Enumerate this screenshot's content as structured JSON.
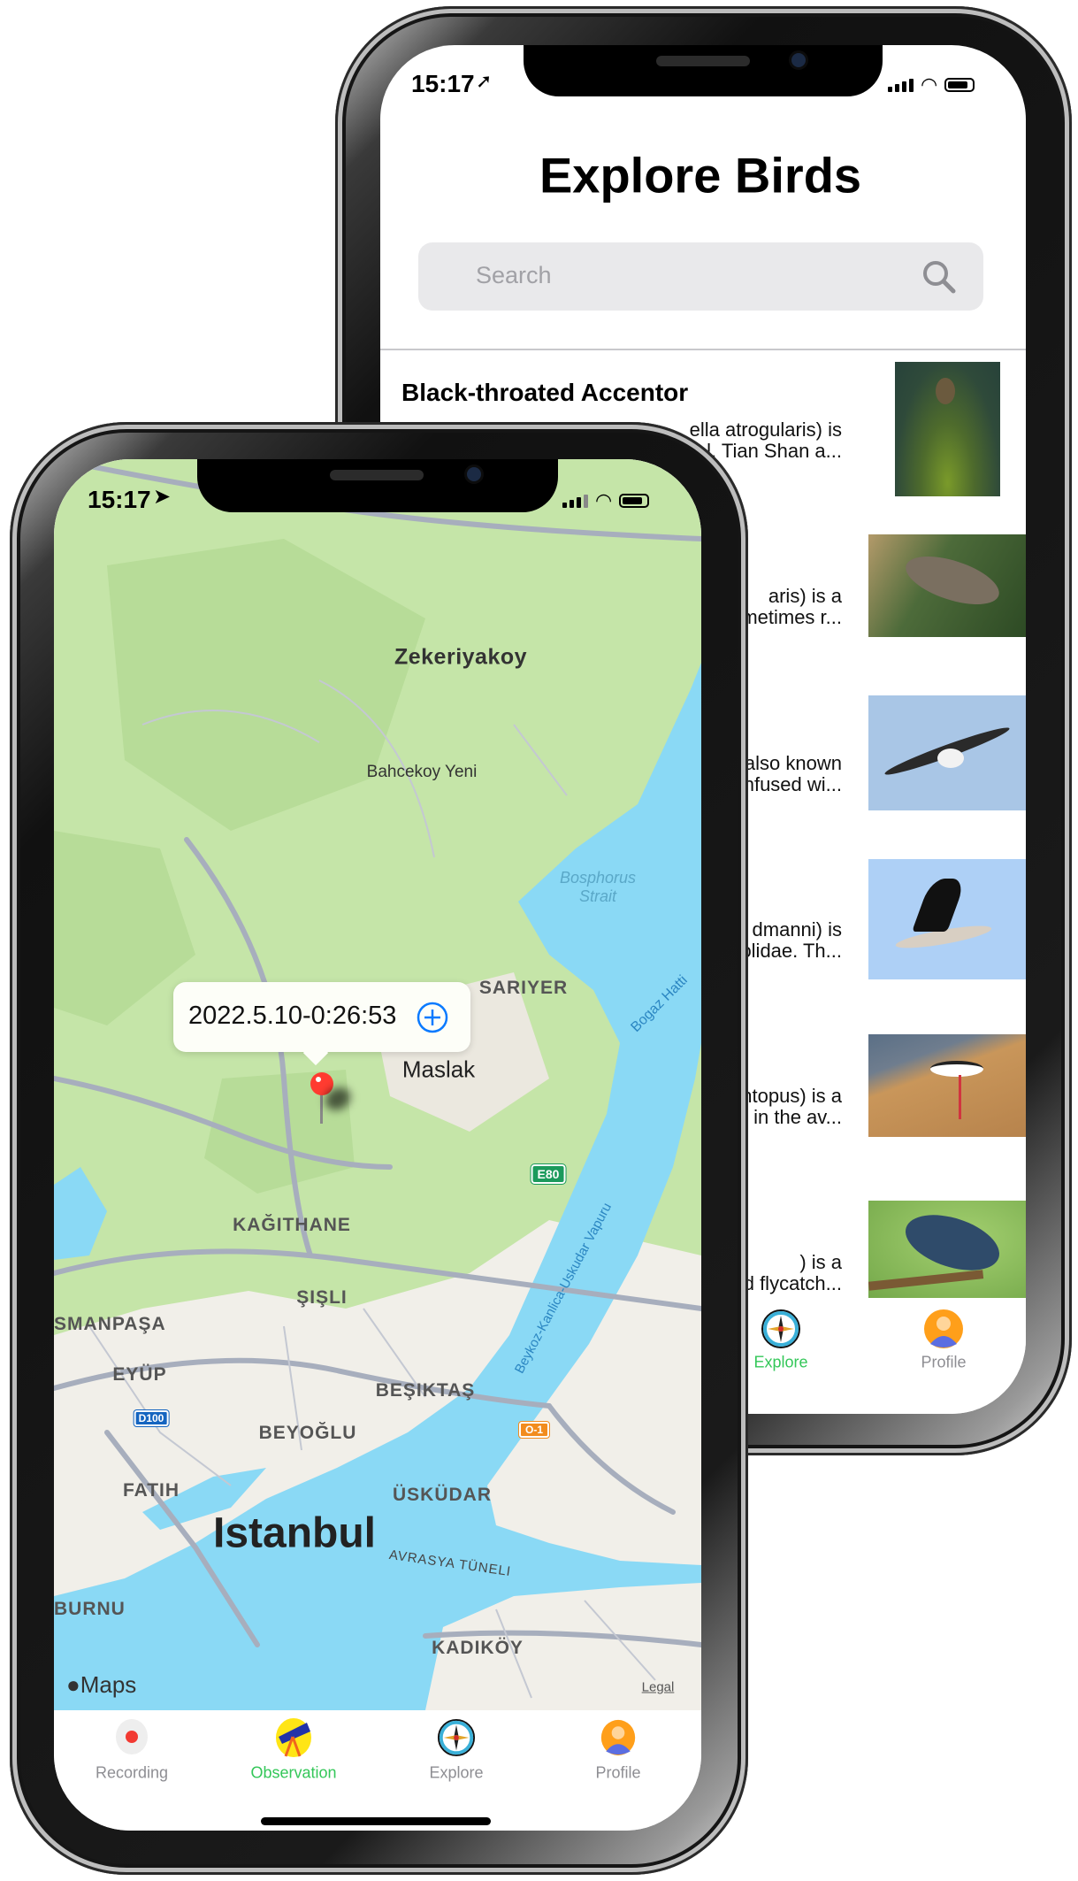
{
  "back_phone": {
    "status": {
      "time": "15:17",
      "location_icon": "location-arrow-icon"
    },
    "title": "Explore Birds",
    "search": {
      "placeholder": "Search",
      "icon": "search-icon"
    },
    "birds": [
      {
        "name": "Black-throated Accentor",
        "desc_line1": "ella atrogularis) is",
        "desc_line2": "l, Tian Shan a..."
      },
      {
        "desc_line1": "aris) is a",
        "desc_line2": "metimes r..."
      },
      {
        "desc_line1": "also known",
        "desc_line2": "nfused wi..."
      },
      {
        "desc_line1": "dmanni) is",
        "desc_line2": "eolidae. Th..."
      },
      {
        "desc_line1": "ntopus) is a",
        "desc_line2": "r in the av..."
      },
      {
        "desc_line1": ") is a",
        "desc_line2": "d flycatch..."
      }
    ],
    "tabs": [
      {
        "label": "Explore",
        "icon": "compass-icon",
        "active": true
      },
      {
        "label": "Profile",
        "icon": "profile-icon",
        "active": false
      }
    ]
  },
  "front_phone": {
    "status": {
      "time": "15:17",
      "location_icon": "location-arrow-icon"
    },
    "map": {
      "labels": {
        "zekeriyakoy": "Zekeriyakoy",
        "bahcekoy": "Bahcekoy Yeni",
        "bosphorus1": "Bosphorus",
        "bosphorus2": "Strait",
        "sariyer": "SARIYER",
        "maslak": "Maslak",
        "kagithane": "KAĞITHANE",
        "sisli": "ŞIŞLI",
        "osmanpasa": "SMANPAŞA",
        "eyup": "EYÜP",
        "besiktas": "BEŞIKTAŞ",
        "beyoglu": "BEYOĞLU",
        "fatih": "FATIH",
        "uskudar": "ÜSKÜDAR",
        "istanbul": "Istanbul",
        "avrasya": "AVRASYA TÜNELI",
        "burnu": "BURNU",
        "kadikoy": "KADIKÖY",
        "bogaz": "Bogaz Hatti",
        "vapuru": "Beykoz-Kanlica-Uskudar Vapuru"
      },
      "shields": {
        "e80": "E80",
        "d100": "D100",
        "o1": "O-1"
      },
      "attribution": "Maps",
      "legal": "Legal",
      "callout": {
        "text": "2022.5.10-0:26:53",
        "action_icon": "plus-circle-icon"
      },
      "pin_color": "#ff3b30"
    },
    "tabs": [
      {
        "label": "Recording",
        "icon": "record-icon",
        "active": false
      },
      {
        "label": "Observation",
        "icon": "telescope-icon",
        "active": true
      },
      {
        "label": "Explore",
        "icon": "compass-icon",
        "active": false
      },
      {
        "label": "Profile",
        "icon": "profile-icon",
        "active": false
      }
    ]
  },
  "colors": {
    "active_tab": "#34c759",
    "inactive_tab": "#8e8e93",
    "accent": "#0a7aff",
    "water": "#8ad9f5",
    "park": "#c5e5a8"
  }
}
